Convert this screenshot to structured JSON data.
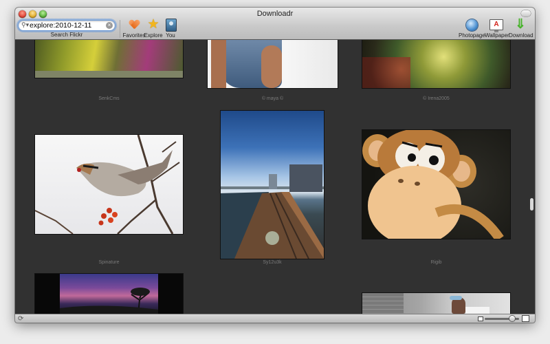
{
  "window": {
    "title": "Downloadr"
  },
  "search": {
    "value": "explore:2010-12-11",
    "label": "Search Flickr"
  },
  "toolbar": {
    "favorites": "Favorites",
    "explore": "Explore",
    "you": "You",
    "photopage": "Photopage",
    "wallpaper": "Wallpaper",
    "download": "Download",
    "wallpaper_glyph": "A"
  },
  "icons": {
    "search": "magnifier-icon",
    "clear": "clear-search-icon",
    "favorites": "heart-icon",
    "explore": "star-icon",
    "you": "user-book-icon",
    "photopage": "globe-icon",
    "wallpaper": "monitor-icon",
    "download": "download-arrow-icon",
    "refresh": "refresh-icon"
  },
  "photos": [
    {
      "caption": "SenkCms"
    },
    {
      "caption": "© maya ©"
    },
    {
      "caption": "© Irena2005"
    },
    {
      "caption": "Spinature"
    },
    {
      "caption": "Sy12u3k"
    },
    {
      "caption": "Rigib"
    },
    {
      "caption": ""
    },
    {
      "caption": ""
    }
  ],
  "zoom": {
    "value": 0.85
  },
  "colors": {
    "focus_ring": "#6a9bdd",
    "content_bg": "#313131"
  }
}
